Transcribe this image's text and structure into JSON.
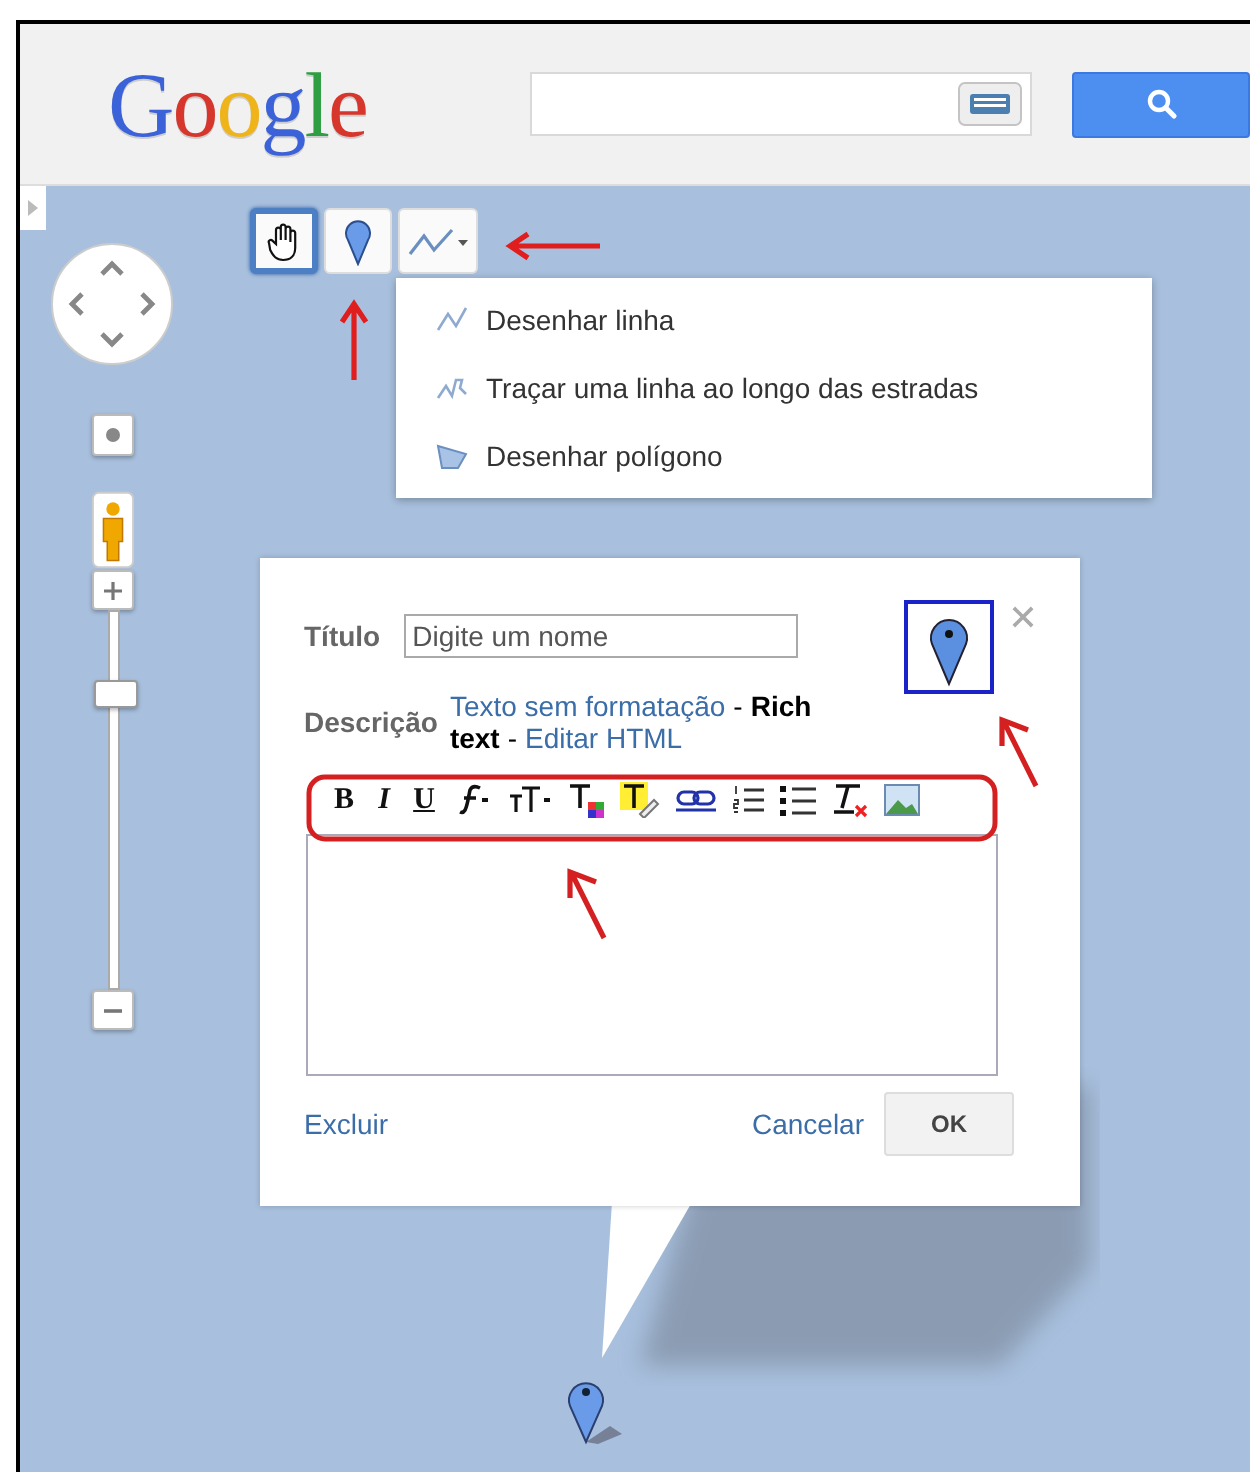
{
  "header": {
    "logo": "Google"
  },
  "map": {
    "tools": [
      {
        "kind": "hand",
        "selected": true
      },
      {
        "kind": "marker",
        "selected": false
      },
      {
        "kind": "line",
        "selected": false
      }
    ],
    "draw_menu": {
      "items": [
        {
          "kind": "line",
          "label": "Desenhar linha"
        },
        {
          "kind": "route",
          "label": "Traçar uma linha ao longo das estradas"
        },
        {
          "kind": "polygon",
          "label": "Desenhar polígono"
        }
      ]
    },
    "zoom": {
      "level": 0.85
    }
  },
  "dialog": {
    "title_label": "Título",
    "title_placeholder": "Digite um nome",
    "description_label": "Descrição",
    "separator": "-",
    "format_options": [
      {
        "kind": "link",
        "text": "Texto sem formatação"
      },
      {
        "kind": "current",
        "text": "Rich text"
      },
      {
        "kind": "link",
        "text": "Editar HTML"
      }
    ],
    "toolbar": [
      {
        "kind": "bold",
        "label": "B"
      },
      {
        "kind": "italic",
        "label": "I"
      },
      {
        "kind": "underline",
        "label": "U"
      },
      {
        "kind": "font"
      },
      {
        "kind": "size"
      },
      {
        "kind": "text-color"
      },
      {
        "kind": "highlight"
      },
      {
        "kind": "link"
      },
      {
        "kind": "numbered-list"
      },
      {
        "kind": "bulleted-list"
      },
      {
        "kind": "clear-format"
      },
      {
        "kind": "image"
      }
    ],
    "delete": "Excluir",
    "cancel": "Cancelar",
    "ok": "OK"
  }
}
